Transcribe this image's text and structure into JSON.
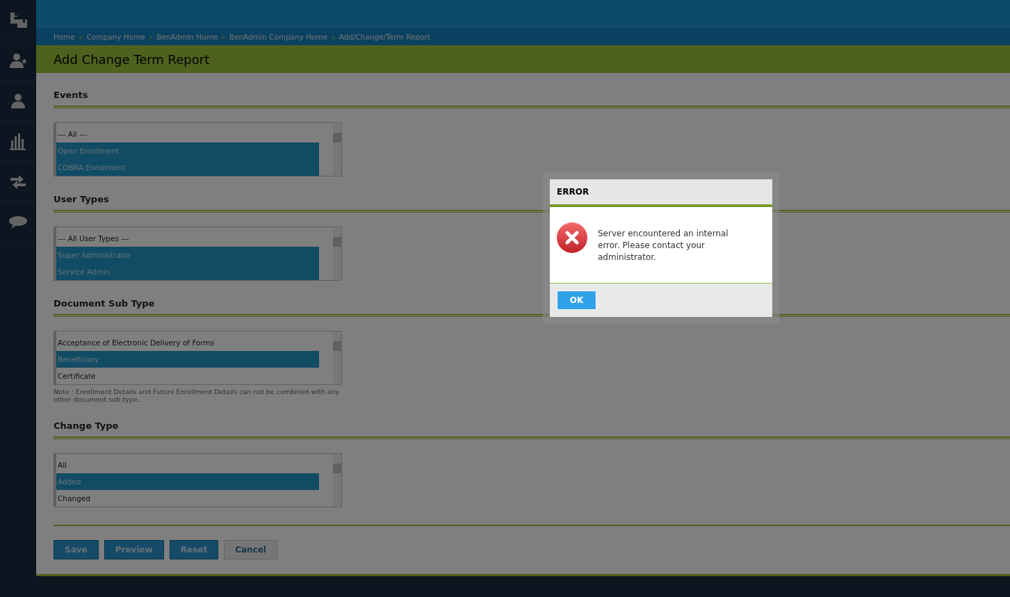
{
  "breadcrumb": {
    "separator": "»",
    "items": [
      "Home",
      "Company Home",
      "BenAdmin Home",
      "BenAdmin Company Home",
      "Add/Change/Term Report"
    ]
  },
  "page_title": "Add Change Term Report",
  "sections": [
    {
      "title": "Events",
      "options": [
        {
          "label": "--- All ---",
          "selected": false
        },
        {
          "label": "Open Enrollment",
          "selected": true
        },
        {
          "label": "COBRA Enrollment",
          "selected": true
        }
      ]
    },
    {
      "title": "User Types",
      "options": [
        {
          "label": "--- All User Types ---",
          "selected": false
        },
        {
          "label": "Super Administrator",
          "selected": true
        },
        {
          "label": "Service Admin",
          "selected": true
        }
      ]
    },
    {
      "title": "Document Sub Type",
      "options": [
        {
          "label": "Acceptance of Electronic Delivery of Forms",
          "selected": false
        },
        {
          "label": "Beneficiary",
          "selected": true
        },
        {
          "label": "Certificate",
          "selected": false
        }
      ],
      "note": "Note : Enrollment Details and Future Enrollment Details can not be combined with any other document sub type.."
    },
    {
      "title": "Change Type",
      "options": [
        {
          "label": "All",
          "selected": false
        },
        {
          "label": "Added",
          "selected": true
        },
        {
          "label": "Changed",
          "selected": false
        }
      ]
    }
  ],
  "buttons": [
    {
      "label": "Save",
      "kind": "primary"
    },
    {
      "label": "Preview",
      "kind": "primary"
    },
    {
      "label": "Reset",
      "kind": "primary"
    },
    {
      "label": "Cancel",
      "kind": "secondary"
    }
  ],
  "dialog": {
    "title": "ERROR",
    "message": "Server encountered an internal error. Please contact your administrator.",
    "button": "OK"
  }
}
